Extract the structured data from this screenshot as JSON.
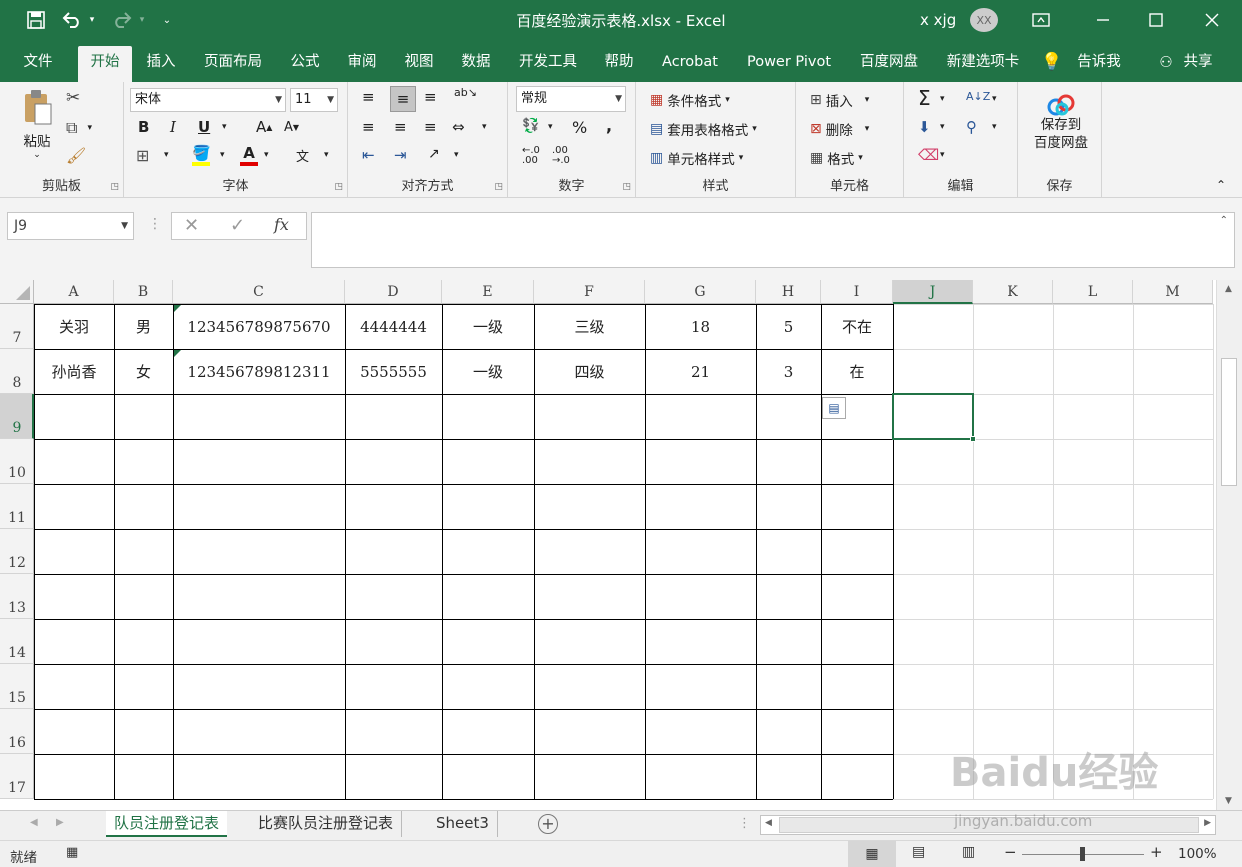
{
  "window": {
    "title": "百度经验演示表格.xlsx  -  Excel",
    "user": "x xjg",
    "avatar": "XX"
  },
  "ribbon_tabs": [
    "文件",
    "开始",
    "插入",
    "页面布局",
    "公式",
    "审阅",
    "视图",
    "数据",
    "开发工具",
    "帮助",
    "Acrobat",
    "Power Pivot",
    "百度网盘",
    "新建选项卡",
    "告诉我",
    "共享"
  ],
  "active_tab": "开始",
  "ribbon": {
    "clipboard": {
      "label": "剪贴板",
      "paste": "粘贴"
    },
    "font": {
      "label": "字体",
      "family": "宋体",
      "size": "11",
      "bold": "B",
      "italic": "I",
      "underline": "U"
    },
    "alignment": {
      "label": "对齐方式"
    },
    "number": {
      "label": "数字",
      "format": "常规",
      "percent": "%",
      "comma": ","
    },
    "styles": {
      "label": "样式",
      "conditional": "条件格式",
      "table": "套用表格格式",
      "cell_styles": "单元格样式"
    },
    "cells": {
      "label": "单元格",
      "insert": "插入",
      "delete": "删除",
      "format": "格式"
    },
    "editing": {
      "label": "编辑"
    },
    "save": {
      "label": "保存",
      "button_line1": "保存到",
      "button_line2": "百度网盘"
    }
  },
  "formula_bar": {
    "name_box": "J9",
    "fx": "fx",
    "formula": ""
  },
  "columns": [
    "A",
    "B",
    "C",
    "D",
    "E",
    "F",
    "G",
    "H",
    "I",
    "J",
    "K",
    "L",
    "M"
  ],
  "selected_cell": "J9",
  "rows": [
    {
      "num": "7",
      "cells": [
        "关羽",
        "男",
        "12345678987567​0",
        "4444444",
        "一级",
        "三级",
        "18",
        "5",
        "不在"
      ]
    },
    {
      "num": "8",
      "cells": [
        "孙尚香",
        "女",
        "123456789812311",
        "5555555",
        "一级",
        "四级",
        "21",
        "3",
        "在"
      ]
    },
    {
      "num": "9",
      "cells": []
    },
    {
      "num": "10",
      "cells": []
    },
    {
      "num": "11",
      "cells": []
    },
    {
      "num": "12",
      "cells": []
    },
    {
      "num": "13",
      "cells": []
    },
    {
      "num": "14",
      "cells": []
    },
    {
      "num": "15",
      "cells": []
    },
    {
      "num": "16",
      "cells": []
    },
    {
      "num": "17",
      "cells": []
    }
  ],
  "sheet_tabs": [
    "队员注册登记表",
    "比赛队员注册登记表",
    "Sheet3"
  ],
  "active_sheet": "队员注册登记表",
  "status": {
    "mode": "就绪",
    "zoom": "100%"
  },
  "watermark": "Baidu经验 jingyan.baidu.com",
  "colors": {
    "excel_green": "#217346",
    "ribbon_bg": "#f3f3f3",
    "grid": "#d4d4d4"
  }
}
